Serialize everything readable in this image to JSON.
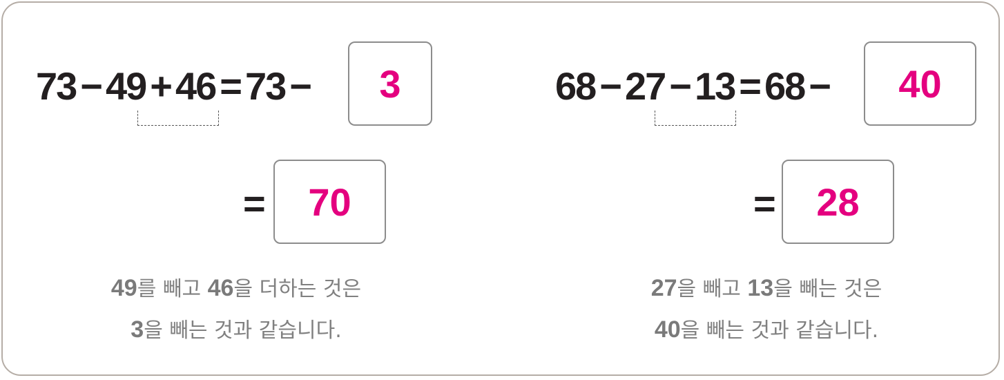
{
  "problems": [
    {
      "expr": {
        "a": "73",
        "op1": "−",
        "b": "49",
        "op2": "+",
        "c": "46",
        "eq": "=",
        "d": "73",
        "op3": "−"
      },
      "box1": "3",
      "eq2": "=",
      "box2": "70",
      "explain": {
        "line1": {
          "n1": "49",
          "t1": "를 빼고 ",
          "n2": "46",
          "t2": "을 더하는 것은"
        },
        "line2": {
          "n1": "3",
          "t1": "을 빼는 것과 같습니다."
        }
      }
    },
    {
      "expr": {
        "a": "68",
        "op1": "−",
        "b": "27",
        "op2": "−",
        "c": "13",
        "eq": "=",
        "d": "68",
        "op3": "−"
      },
      "box1": "40",
      "eq2": "=",
      "box2": "28",
      "explain": {
        "line1": {
          "n1": "27",
          "t1": "을 빼고 ",
          "n2": "13",
          "t2": "을 빼는 것은"
        },
        "line2": {
          "n1": "40",
          "t1": "을 빼는 것과 같습니다."
        }
      }
    }
  ],
  "colors": {
    "answer": "#e4007f",
    "text": "#231f20",
    "explain": "#808080",
    "border": "#b5ada6"
  }
}
